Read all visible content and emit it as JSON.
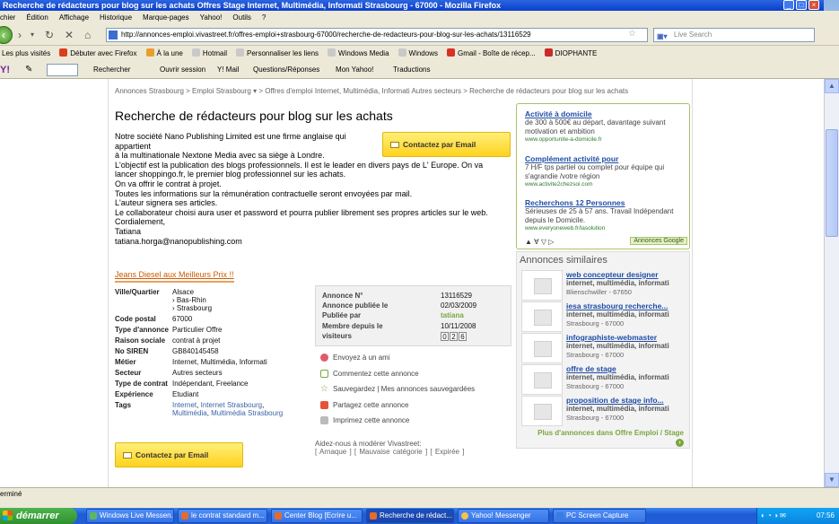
{
  "window": {
    "title": "Recherche de rédacteurs pour blog sur les achats Offres Stage Internet, Multimédia, Informati Strasbourg - 67000 - Mozilla Firefox"
  },
  "menu": [
    "chier",
    "Édition",
    "Affichage",
    "Historique",
    "Marque-pages",
    "Yahoo!",
    "Outils",
    "?"
  ],
  "nav": {
    "url": "http://annonces-emploi.vivastreet.fr/offres-emploi+strasbourg-67000/recherche-de-redacteurs-pour-blog-sur-les-achats/13116529",
    "search_placeholder": "Live Search"
  },
  "bookmarks": [
    "Les plus visités",
    "Débuter avec Firefox",
    "À la une",
    "Hotmail",
    "Personnaliser les liens",
    "Windows Media",
    "Windows",
    "Gmail - Boîte de récep...",
    "DIOPHANTE"
  ],
  "yahoo_toolbar": {
    "search": "Rechercher",
    "login": "Ouvrir session",
    "mail": "Y! Mail",
    "qa": "Questions/Réponses",
    "my": "Mon Yahoo!",
    "translate": "Traductions"
  },
  "page": {
    "breadcrumb": "Annonces Strasbourg > Emploi Strasbourg ▾ > Offres d'emploi Internet, Multimédia, Informati Autres secteurs > Recherche de rédacteurs pour blog sur les achats",
    "title": "Recherche de rédacteurs pour blog sur les achats",
    "description": [
      "Notre société Nano Publishing Limited est une firme anglaise qui",
      "appartient",
      "à la multinationale Nextone Media avec sa siège à Londre.",
      "L'objectif est la publication des blogs professionnels. Il est le leader en divers pays de L' Europe. On va",
      "lancer shoppingo.fr, le premier blog professionnel sur les achats.",
      "On va offrir le contrat à projet.",
      "Toutes les informations sur la rémunération contractuelle seront envoyées par mail.",
      "L'auteur signera ses articles.",
      "Le collaborateur choisi aura user et password et pourra publier librement ses propres articles sur le web.",
      "Cordialement,",
      "Tatiana",
      "tatiana.horga@nanopublishing.com"
    ],
    "contact_label": "Contactez par Email",
    "promo_link": "Jeans Diesel aux Meilleurs Prix !!",
    "details": {
      "ville_label": "Ville/Quartier",
      "ville": [
        "Alsace",
        "› Bas-Rhin",
        "› Strasbourg"
      ],
      "code_label": "Code postal",
      "code": "67000",
      "type_label": "Type d'annonce",
      "type": "Particulier Offre",
      "raison_label": "Raison sociale",
      "raison": "contrat à projet",
      "siren_label": "No SIREN",
      "siren": "GB840145458",
      "metier_label": "Métier",
      "metier": "Internet, Multimédia, Informati",
      "secteur_label": "Secteur",
      "secteur": "Autres secteurs",
      "contrat_label": "Type de contrat",
      "contrat": "Indépendant, Freelance",
      "experience_label": "Expérience",
      "experience": "Etudiant",
      "tags_label": "Tags",
      "tags": [
        "Internet",
        "Internet Strasbourg",
        "Multimédia",
        "Multimédia Strasbourg"
      ]
    },
    "annonce": {
      "num_label": "Annonce N°",
      "num": "13116529",
      "date_label": "Annonce publiée le",
      "date": "02/03/2009",
      "by_label": "Publiée par",
      "by": "tatiana",
      "member_label": "Membre depuis le",
      "member_label2": "visiteurs",
      "member_date": "10/11/2008",
      "visitors": [
        "0",
        "2",
        "6"
      ]
    },
    "actions": [
      "Envoyez à un ami",
      "Commentez cette annonce",
      "Sauvegardez | Mes annonces sauvegardées",
      "Partagez cette annonce",
      "Imprimez cette annonce"
    ],
    "moderate_label": "Aidez-nous à modérer Vivastreet:",
    "moderate_links": "[ Arnaque ]   [ Mauvaise catégorie ]   [ Expirée ]"
  },
  "ads": [
    {
      "title": "Activité à domicile",
      "text": "de 300 à 500€ au départ, davantage suivant motivation et ambition",
      "url": "www.opportunite-a-domicile.fr"
    },
    {
      "title": "Complément activité pour",
      "text": "7 H/F tps partiel ou complet pour équipe qui s'agrandie /votre région",
      "url": "www.activite2chezsoi.com"
    },
    {
      "title": "Recherchons 12 Personnes",
      "text": "Sérieuses de 25 à 57 ans. Travail Indépendant depuis le Domicile.",
      "url": "www.everyoneweb.fr/lasolution"
    }
  ],
  "ads_footer": "▲ ∀ ▽ ▷",
  "ads_badge": "Annonces Google",
  "similar": {
    "title": "Annonces similaires",
    "items": [
      {
        "title": "web concepteur designer",
        "cat": "internet, multimédia, informati",
        "loc": "Blienschwiller - 67650"
      },
      {
        "title": "iesa strasbourg recherche...",
        "cat": "internet, multimédia, informati",
        "loc": "Strasbourg - 67000"
      },
      {
        "title": "infographiste-webmaster",
        "cat": "internet, multimédia, informati",
        "loc": "Strasbourg - 67000"
      },
      {
        "title": "offre de stage",
        "cat": "internet, multimédia, informati",
        "loc": "Strasbourg - 67000"
      },
      {
        "title": "proposition de stage info...",
        "cat": "internet, multimédia, informati",
        "loc": "Strasbourg - 67000"
      }
    ],
    "more": "Plus d'annonces dans Offre Emploi / Stage"
  },
  "status": "erminé",
  "taskbar": {
    "start": "démarrer",
    "tasks": [
      "Windows Live Messen...",
      "le contrat standard m...",
      "Center Blog [Ecrire u...",
      "Recherche de rédact...",
      "Yahoo! Messenger",
      "PC Screen Capture"
    ],
    "clock": "07:56"
  },
  "colors": {
    "accent": "#1f4da6",
    "green": "#7ba540",
    "button": "#ffd21e"
  }
}
